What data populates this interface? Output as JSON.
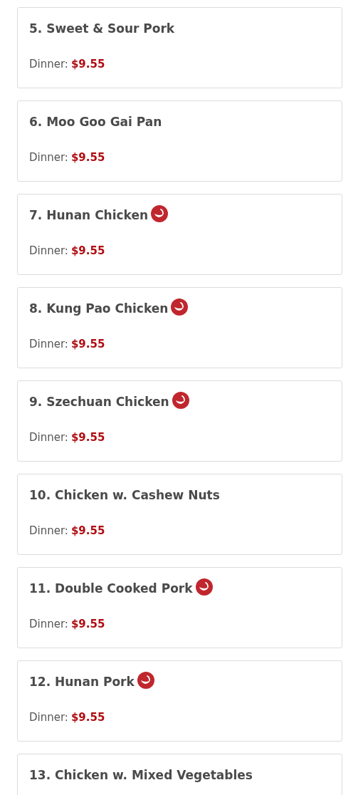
{
  "items": [
    {
      "name": "5. Sweet & Sour Pork",
      "spicy": false,
      "price_label": "Dinner:",
      "price": "$9.55"
    },
    {
      "name": "6. Moo Goo Gai Pan",
      "spicy": false,
      "price_label": "Dinner:",
      "price": "$9.55"
    },
    {
      "name": "7. Hunan Chicken",
      "spicy": true,
      "price_label": "Dinner:",
      "price": "$9.55"
    },
    {
      "name": "8. Kung Pao Chicken",
      "spicy": true,
      "price_label": "Dinner:",
      "price": "$9.55"
    },
    {
      "name": "9. Szechuan Chicken",
      "spicy": true,
      "price_label": "Dinner:",
      "price": "$9.55"
    },
    {
      "name": "10. Chicken w. Cashew Nuts",
      "spicy": false,
      "price_label": "Dinner:",
      "price": "$9.55"
    },
    {
      "name": "11. Double Cooked Pork",
      "spicy": true,
      "price_label": "Dinner:",
      "price": "$9.55"
    },
    {
      "name": "12. Hunan Pork",
      "spicy": true,
      "price_label": "Dinner:",
      "price": "$9.55"
    },
    {
      "name": "13. Chicken w. Mixed Vegetables",
      "spicy": false
    }
  ]
}
